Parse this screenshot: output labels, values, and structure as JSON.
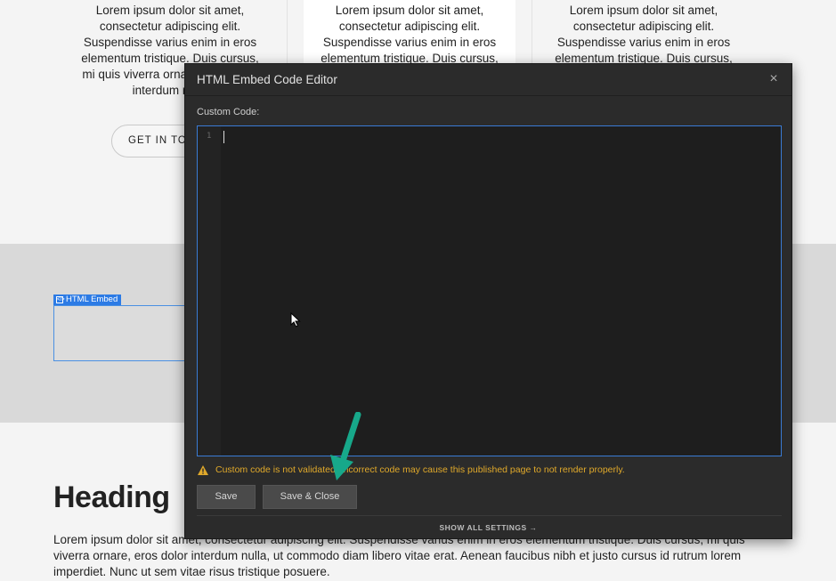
{
  "page": {
    "columns": [
      {
        "text": "Lorem ipsum dolor sit amet, consectetur adipiscing elit. Suspendisse varius enim in eros elementum tristique. Duis cursus, mi quis viverra ornare, eros dolor interdum nulla"
      },
      {
        "text": "Lorem ipsum dolor sit amet, consectetur adipiscing elit. Suspendisse varius enim in eros elementum tristique. Duis cursus,"
      },
      {
        "text": "Lorem ipsum dolor sit amet, consectetur adipiscing elit. Suspendisse varius enim in eros elementum tristique. Duis cursus,"
      }
    ],
    "cta_button": "GET IN TOUCH",
    "embed_tag_label": "HTML Embed",
    "embed_tag_icon": "</>",
    "heading": "Heading",
    "body_text": "Lorem ipsum dolor sit amet, consectetur adipiscing elit. Suspendisse varius enim in eros elementum tristique. Duis cursus, mi quis viverra ornare, eros dolor interdum nulla, ut commodo diam libero vitae erat. Aenean faucibus nibh et justo cursus id rutrum lorem imperdiet. Nunc ut sem vitae risus tristique posuere."
  },
  "modal": {
    "title": "HTML Embed Code Editor",
    "close_icon": "×",
    "field_label": "Custom Code:",
    "line_number": "1",
    "code_value": "",
    "warning_text": "Custom code is not validated. Incorrect code may cause this published page to not render properly.",
    "save_label": "Save",
    "save_close_label": "Save & Close",
    "show_settings_label": "SHOW ALL SETTINGS →"
  },
  "colors": {
    "modal_bg": "#2b2b2b",
    "editor_bg": "#1e1e1e",
    "accent_blue": "#2c7be5",
    "warning": "#e0a92b",
    "annotation_arrow": "#17a88a"
  }
}
